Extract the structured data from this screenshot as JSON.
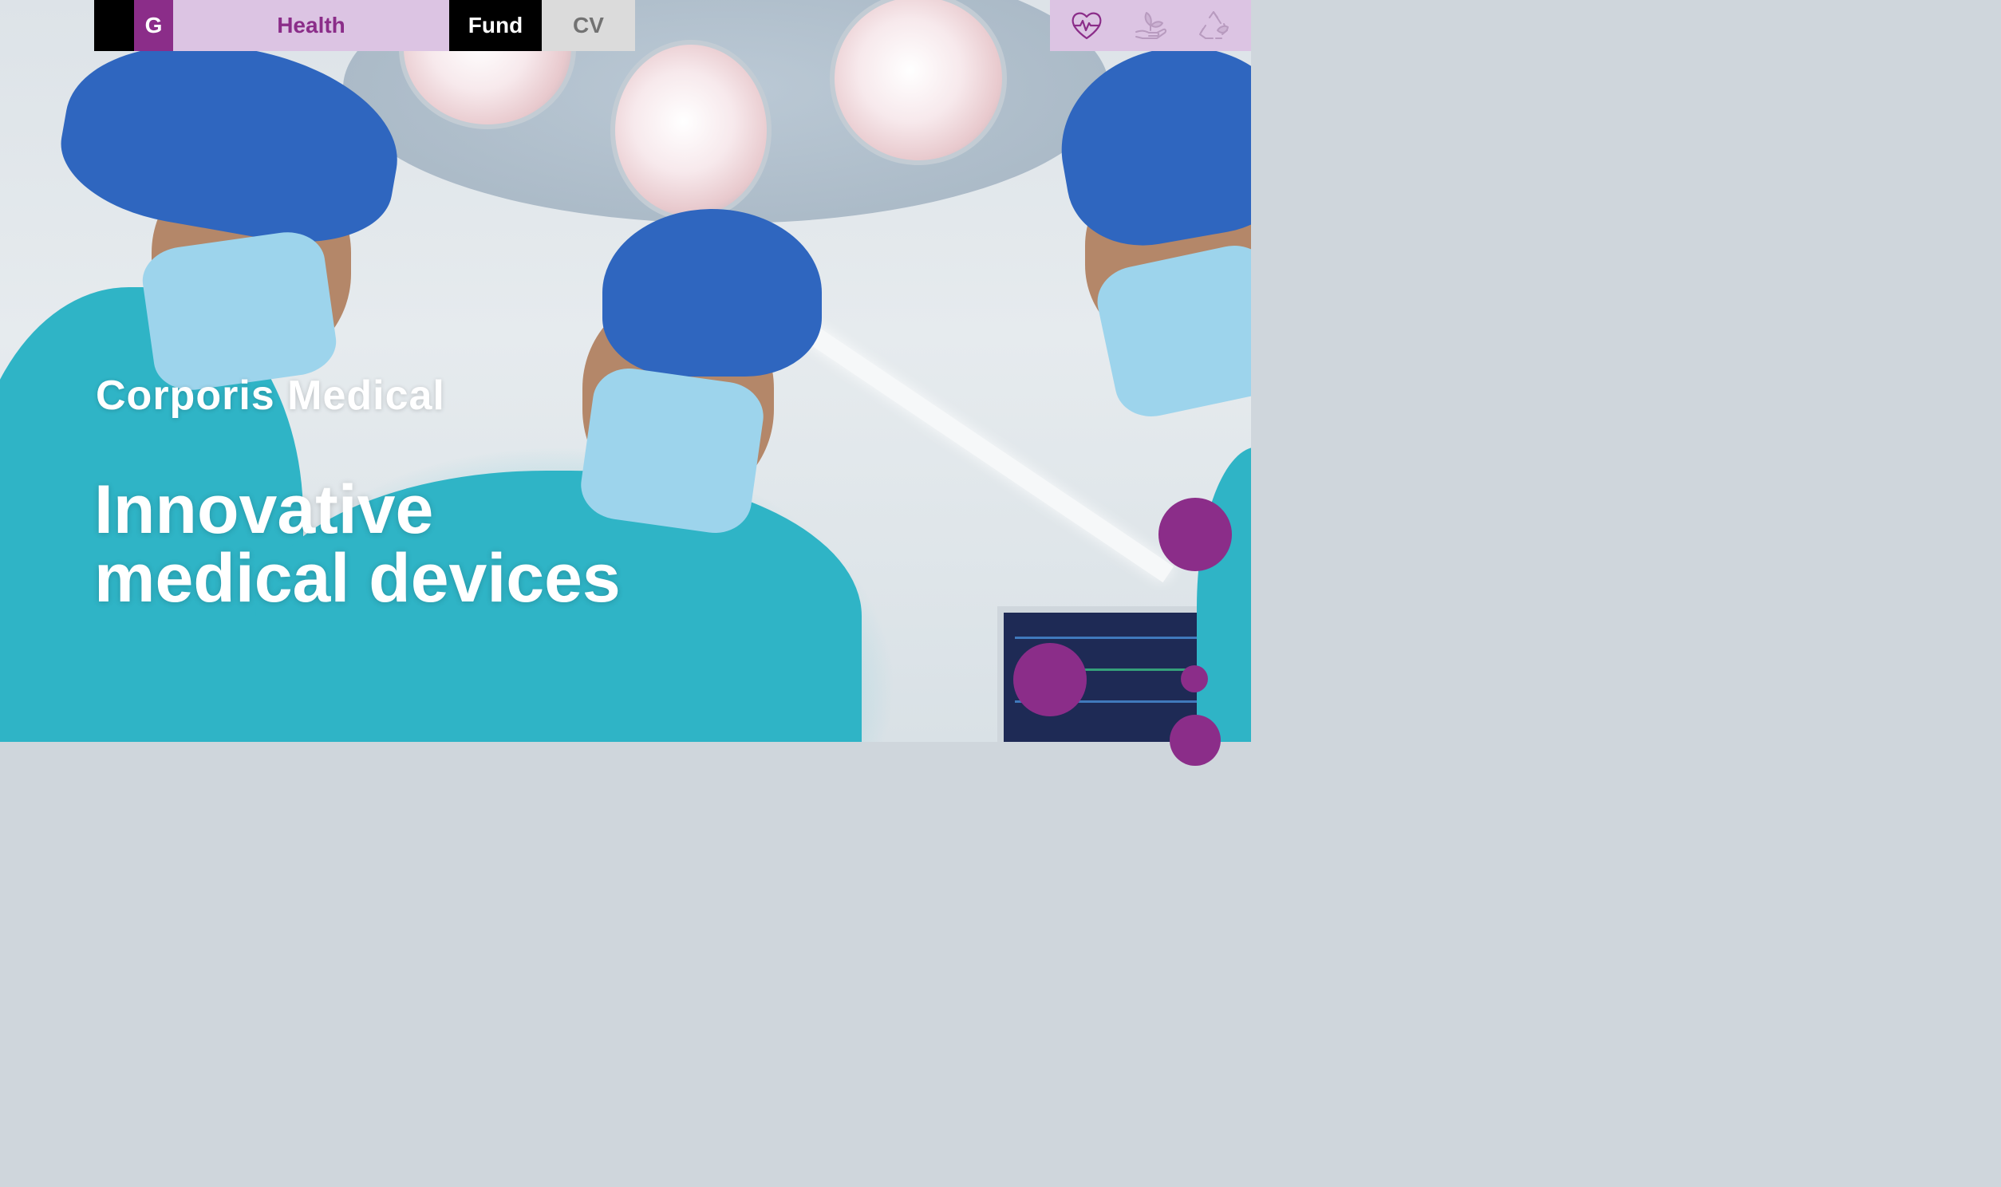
{
  "nav": {
    "g_label": "G",
    "health_label": "Health",
    "fund_label": "Fund",
    "cv_label": "CV"
  },
  "icons": [
    "heart-pulse-icon",
    "plant-hand-icon",
    "recycle-leaf-icon"
  ],
  "hero": {
    "brand": "Corporis Medical",
    "headline_line1": "Innovative",
    "headline_line2": "medical devices"
  },
  "colors": {
    "brand_purple": "#8b2d89",
    "light_purple": "#dcc4e3",
    "black": "#000000",
    "grey": "#dbdbdb",
    "grey_text": "#727272"
  }
}
